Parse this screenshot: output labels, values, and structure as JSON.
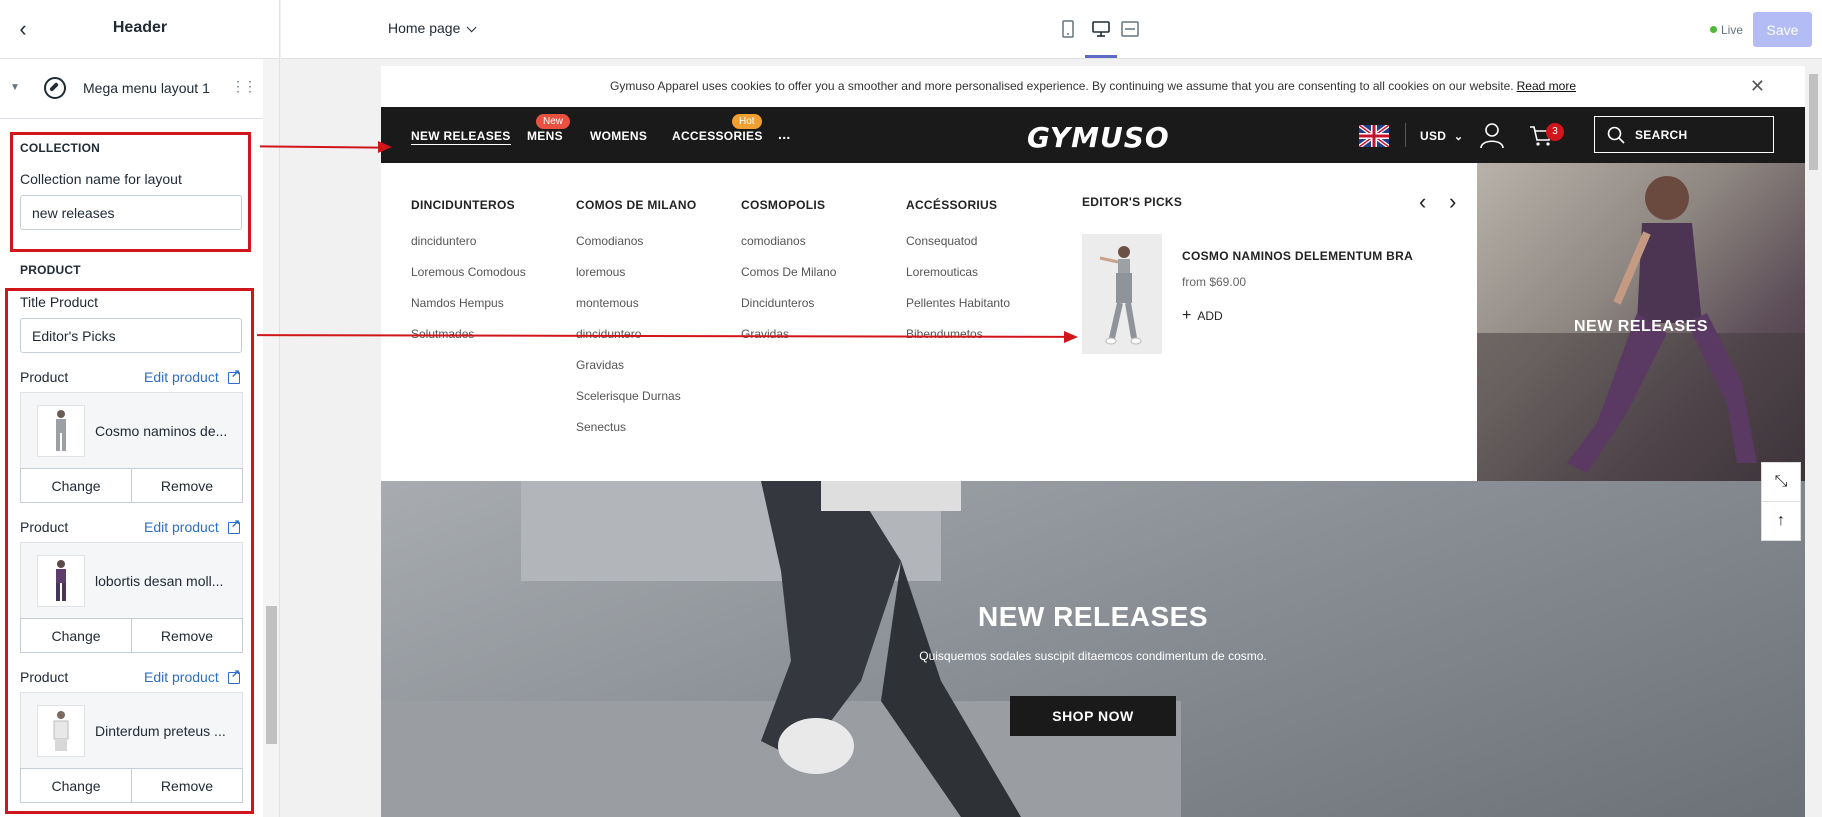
{
  "sidebar": {
    "title": "Header",
    "mega_item": "Mega menu layout 1",
    "collection": {
      "section": "COLLECTION",
      "field_label": "Collection name for layout",
      "value": "new releases"
    },
    "product": {
      "section": "PRODUCT",
      "title_label": "Title Product",
      "title_value": "Editor's Picks",
      "items": [
        {
          "label": "Product",
          "edit": "Edit product",
          "name": "Cosmo naminos de...",
          "change": "Change",
          "remove": "Remove"
        },
        {
          "label": "Product",
          "edit": "Edit product",
          "name": "lobortis desan moll...",
          "change": "Change",
          "remove": "Remove"
        },
        {
          "label": "Product",
          "edit": "Edit product",
          "name": "Dinterdum preteus ...",
          "change": "Change",
          "remove": "Remove"
        }
      ]
    }
  },
  "topbar": {
    "page": "Home page",
    "live": "Live",
    "save": "Save"
  },
  "preview": {
    "cookie_text": "Gymuso Apparel uses cookies to offer you a smoother and more personalised experience. By continuing we assume that you are consenting to all cookies on our website.",
    "cookie_link": "Read more",
    "nav": [
      {
        "label": "NEW RELEASES",
        "badge": ""
      },
      {
        "label": "MENS",
        "badge": "New"
      },
      {
        "label": "WOMENS",
        "badge": ""
      },
      {
        "label": "ACCESSORIES",
        "badge": "Hot"
      },
      {
        "label": "...",
        "badge": ""
      }
    ],
    "logo": "GYMUSO",
    "currency": "USD",
    "cart_count": "3",
    "search": "SEARCH",
    "mega_columns": [
      {
        "heading": "DINCIDUNTEROS",
        "links": [
          "dinciduntero",
          "Loremous Comodous",
          "Namdos Hempus",
          "Solutmades"
        ]
      },
      {
        "heading": "COMOS DE MILANO",
        "links": [
          "Comodianos",
          "loremous",
          "montemous",
          "dinciduntero",
          "Gravidas",
          "Scelerisque Durnas",
          "Senectus"
        ]
      },
      {
        "heading": "COSMOPOLIS",
        "links": [
          "comodianos",
          "Comos De Milano",
          "Dincidunteros",
          "Gravidas"
        ]
      },
      {
        "heading": "ACCÉSSORIUS",
        "links": [
          "Consequatod",
          "Loremouticas",
          "Pellentes Habitanto",
          "Bibendumetos"
        ]
      }
    ],
    "editors_picks": {
      "title": "EDITOR'S PICKS",
      "product_name": "COSMO NAMINOS DELEMENTUM BRA",
      "price": "from $69.00",
      "add": "ADD"
    },
    "mega_banner": "NEW RELEASES",
    "hero": {
      "title": "NEW RELEASES",
      "subtitle": "Quisquemos sodales suscipit ditaemcos condimentum de cosmo.",
      "button": "SHOP NOW"
    }
  },
  "colors": {
    "accent": "#5c6ac4",
    "annotation_red": "#d0161b",
    "link_blue": "#2c6ecb",
    "nav_bg": "#1a1a1a"
  }
}
